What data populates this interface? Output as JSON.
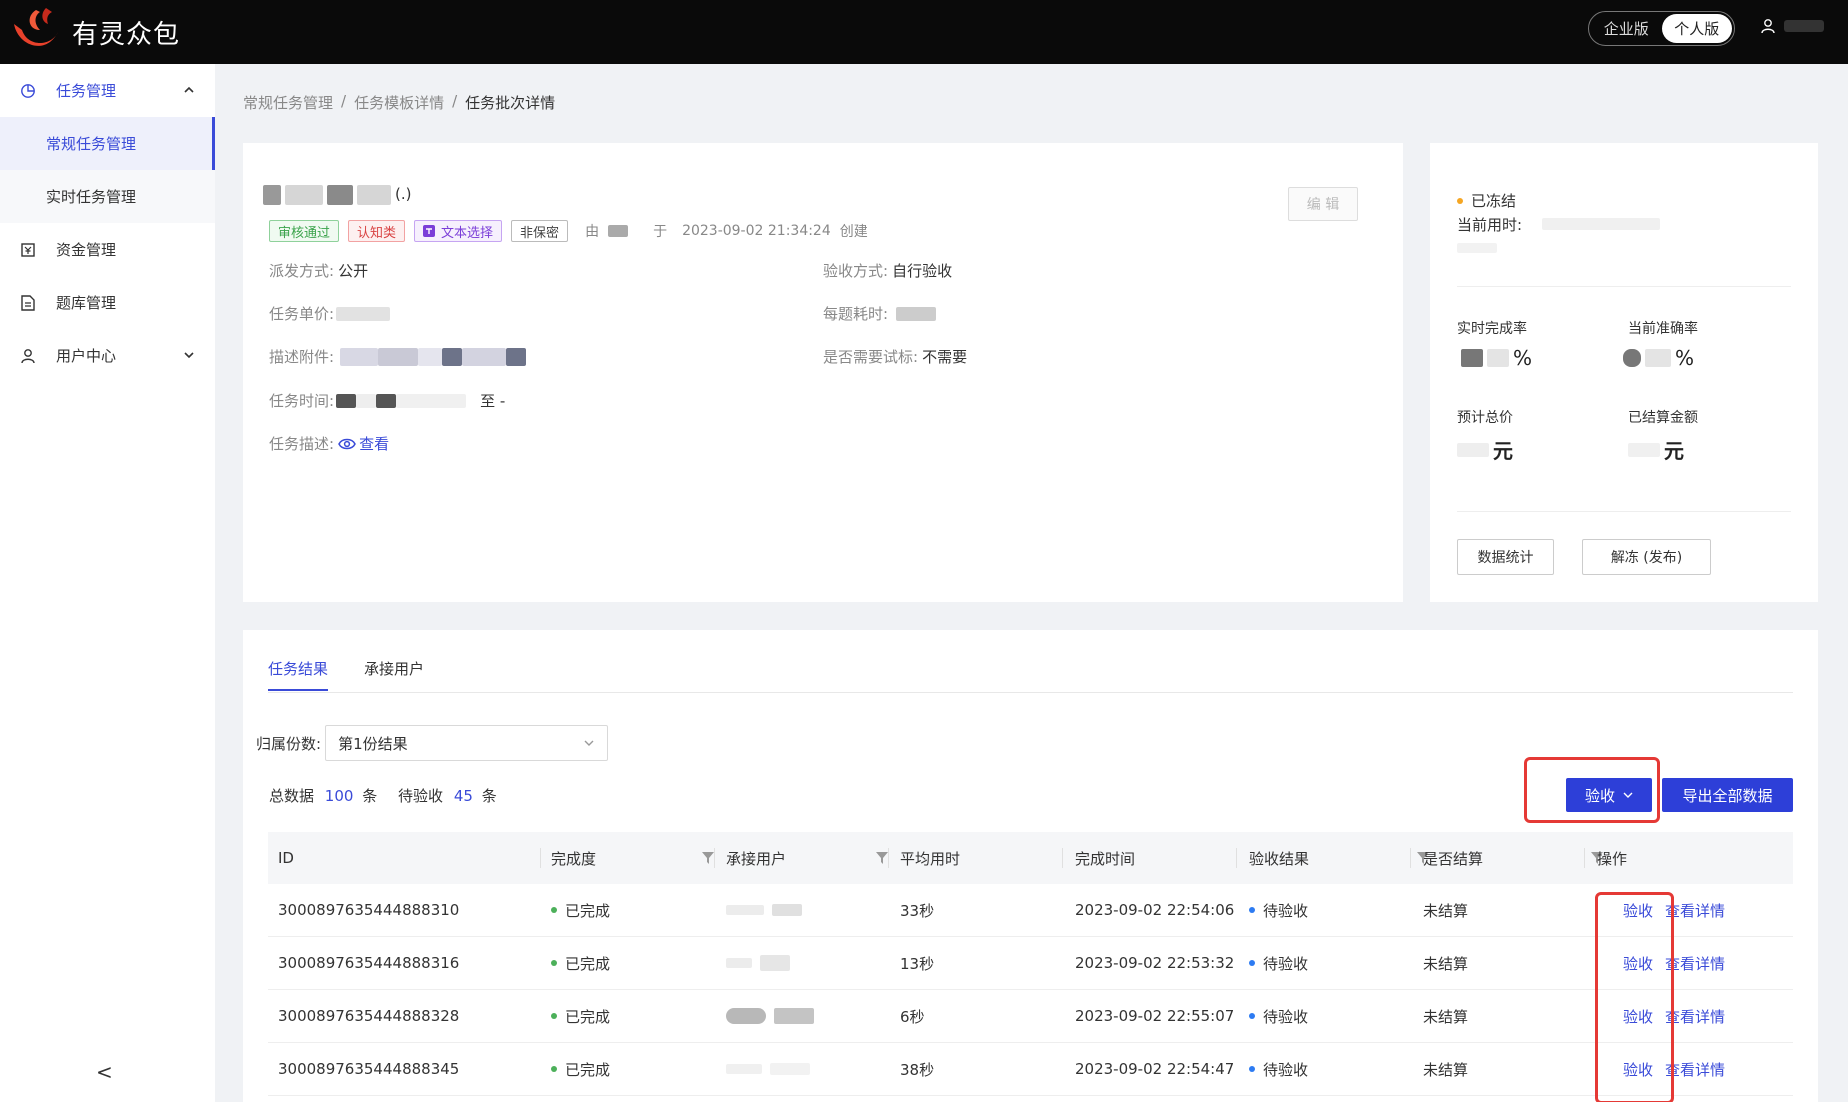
{
  "header": {
    "logo_text": "有灵众包",
    "editions": [
      "企业版",
      "个人版"
    ],
    "active_edition": "个人版"
  },
  "sidebar": {
    "items": [
      {
        "label": "任务管理",
        "icon": "pie-chart-icon",
        "expanded": true
      },
      {
        "label": "常规任务管理",
        "sub": true,
        "active": true
      },
      {
        "label": "实时任务管理",
        "sub": true
      },
      {
        "label": "资金管理",
        "icon": "wallet-icon"
      },
      {
        "label": "题库管理",
        "icon": "document-icon"
      },
      {
        "label": "用户中心",
        "icon": "user-icon",
        "expandable": true
      }
    ],
    "collapse_glyph": "<"
  },
  "breadcrumb": [
    "常规任务管理",
    "/",
    "任务模板详情",
    "/",
    "任务批次详情"
  ],
  "info": {
    "title_suffix": "(.)",
    "tags": [
      "审核通过",
      "认知类",
      "文本选择",
      "非保密"
    ],
    "by_label": "由",
    "at_label": "于",
    "created_time": "2023-09-02 21:34:24",
    "created_label": "创建",
    "edit_label": "编 辑",
    "dispatch_label": "派发方式:",
    "dispatch_value": "公开",
    "accept_label": "验收方式:",
    "accept_value": "自行验收",
    "price_label": "任务单价:",
    "per_time_label": "每题耗时:",
    "attach_label": "描述附件:",
    "trial_label": "是否需要试标:",
    "trial_value": "不需要",
    "time_label": "任务时间:",
    "time_to": "至 -",
    "desc_label": "任务描述:",
    "view_label": "查看"
  },
  "stats": {
    "status": "已冻结",
    "elapsed_label": "当前用时:",
    "completion_label": "实时完成率",
    "accuracy_label": "当前准确率",
    "percent_unit": "%",
    "total_price_label": "预计总价",
    "settled_label": "已结算金额",
    "yuan_unit": "元",
    "stats_btn": "数据统计",
    "unfreeze_btn": "解冻 (发布)"
  },
  "results": {
    "tabs": [
      "任务结果",
      "承接用户"
    ],
    "share_label": "归属份数:",
    "share_value": "第1份结果",
    "total_label": "总数据",
    "total_count": "100",
    "unit": "条",
    "pending_label": "待验收",
    "pending_count": "45",
    "verify_btn": "验收",
    "export_btn": "导出全部数据",
    "columns": [
      "ID",
      "完成度",
      "承接用户",
      "平均用时",
      "完成时间",
      "验收结果",
      "是否结算",
      "操作"
    ],
    "rows": [
      {
        "id": "3000897635444888310",
        "status": "已完成",
        "avg": "33秒",
        "time": "2023-09-02 22:54:06",
        "result": "待验收",
        "settled": "未结算",
        "op1": "验收",
        "op2": "查看详情"
      },
      {
        "id": "3000897635444888316",
        "status": "已完成",
        "avg": "13秒",
        "time": "2023-09-02 22:53:32",
        "result": "待验收",
        "settled": "未结算",
        "op1": "验收",
        "op2": "查看详情"
      },
      {
        "id": "3000897635444888328",
        "status": "已完成",
        "avg": "6秒",
        "time": "2023-09-02 22:55:07",
        "result": "待验收",
        "settled": "未结算",
        "op1": "验收",
        "op2": "查看详情"
      },
      {
        "id": "3000897635444888345",
        "status": "已完成",
        "avg": "38秒",
        "time": "2023-09-02 22:54:47",
        "result": "待验收",
        "settled": "未结算",
        "op1": "验收",
        "op2": "查看详情"
      }
    ]
  },
  "colors": {
    "accent": "#3a4bd8",
    "primary_button": "#2d3fd8",
    "highlight": "#e53935",
    "topbar": "#0a0a0a"
  }
}
